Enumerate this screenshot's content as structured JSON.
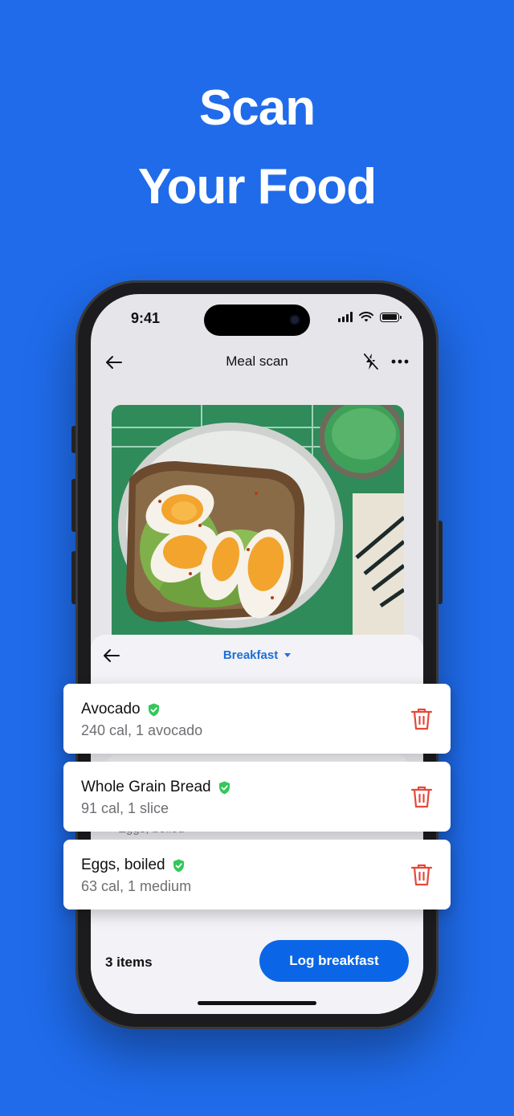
{
  "headline": {
    "line1": "Scan",
    "line2": "Your Food"
  },
  "status_bar": {
    "time": "9:41"
  },
  "nav": {
    "title": "Meal scan"
  },
  "sheet": {
    "meal_selector": "Breakfast",
    "ghost_label": "Eggs, boiled"
  },
  "food_items": [
    {
      "name": "Avocado",
      "detail": "240 cal, 1 avocado"
    },
    {
      "name": "Whole Grain Bread",
      "detail": "91 cal, 1 slice"
    },
    {
      "name": "Eggs, boiled",
      "detail": "63 cal, 1 medium"
    }
  ],
  "footer": {
    "item_count": "3 items",
    "log_button": "Log breakfast"
  },
  "colors": {
    "background": "#1f6bea",
    "accent": "#0a66e6",
    "verified": "#34c759",
    "delete": "#e5483b"
  }
}
